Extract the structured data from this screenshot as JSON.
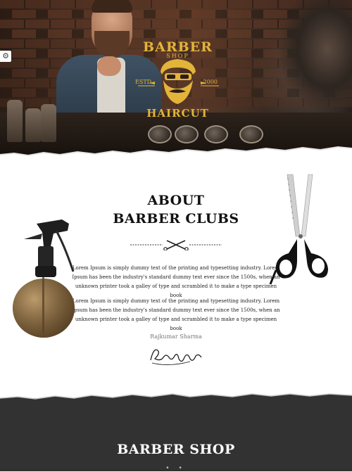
{
  "hero": {
    "settings_icon": "gear-icon",
    "logo": {
      "line1": "BARBER",
      "line2": "SHOP",
      "left_mark": "ESTD",
      "right_mark": "2000",
      "line3": "HAIRCUT",
      "color": "#e2b43a"
    }
  },
  "about": {
    "title_line1": "ABOUT",
    "title_line2": "BARBER CLUBS",
    "divider_icon": "crossed-scissors-icon",
    "paragraph1": "Lorem Ipsum is simply dummy text of the printing and typesetting industry. Lorem Ipsum has been the industry's standard dummy text ever since the 1500s, when an unknown printer took a galley of type and scrambled it to make a type specimen book",
    "paragraph2": "Lorem Ipsum is simply dummy text of the printing and typesetting industry. Lorem Ipsum has been the industry's standard dummy text ever since the 1500s, when an unknown printer took a galley of type and scrambled it to make a type specimen book",
    "author": "Rajkumar Sharma",
    "signature": "Robertmyles"
  },
  "barber_shop": {
    "title": "BARBER SHOP",
    "dots": "• •"
  },
  "colors": {
    "accent_gold": "#e2b43a",
    "dark_band": "#323232",
    "text": "#222222"
  }
}
